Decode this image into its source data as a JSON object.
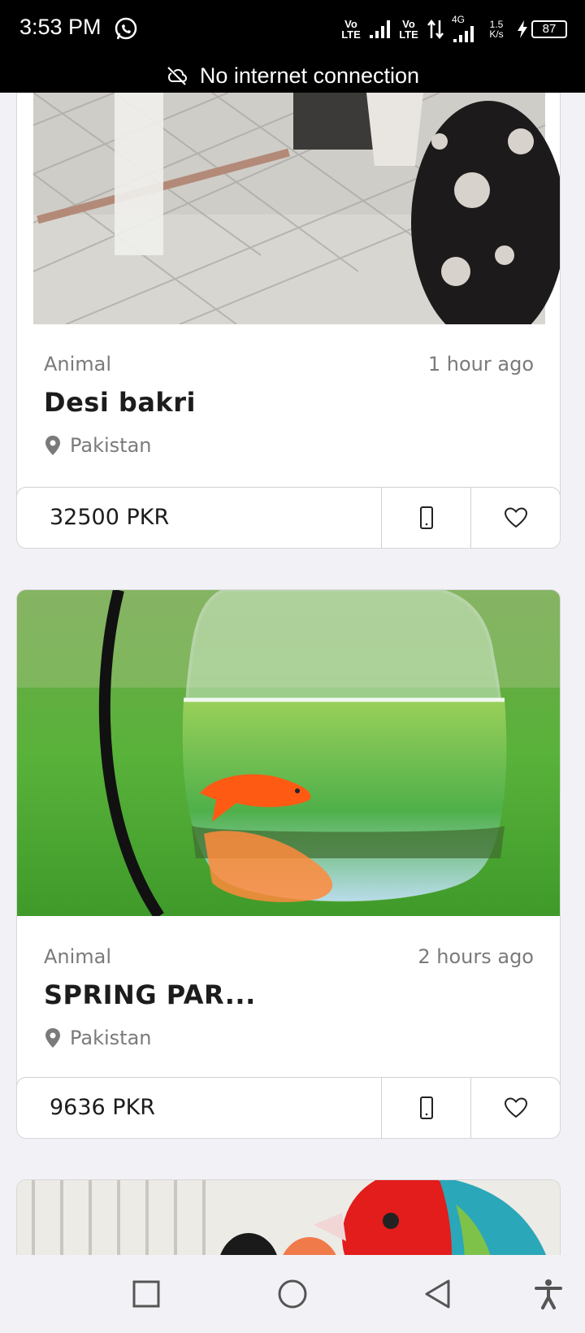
{
  "status_bar": {
    "time": "3:53 PM",
    "volte1": "Vo LTE",
    "volte2": "Vo LTE",
    "network": "4G",
    "speed_value": "1.5",
    "speed_unit": "K/s",
    "battery": "87"
  },
  "banner": {
    "text": "No internet connection"
  },
  "listings": [
    {
      "category": "Animal",
      "time": "1 hour ago",
      "title": "Desi bakri",
      "location": "Pakistan",
      "price": "32500 PKR"
    },
    {
      "category": "Animal",
      "time": "2 hours ago",
      "title": "SPRING PAR...",
      "location": "Pakistan",
      "price": "9636 PKR"
    }
  ],
  "icons": {
    "whatsapp": "whatsapp-icon",
    "no_internet": "cloud-off-icon",
    "location": "location-pin-icon",
    "phone": "phone-icon",
    "favorite": "heart-icon",
    "recents": "square-icon",
    "home": "circle-icon",
    "back": "triangle-back-icon",
    "accessibility": "accessibility-icon"
  },
  "colors": {
    "background": "#f2f2f6",
    "status_bar": "#000000",
    "card": "#ffffff",
    "muted_text": "#7a7a7a"
  }
}
